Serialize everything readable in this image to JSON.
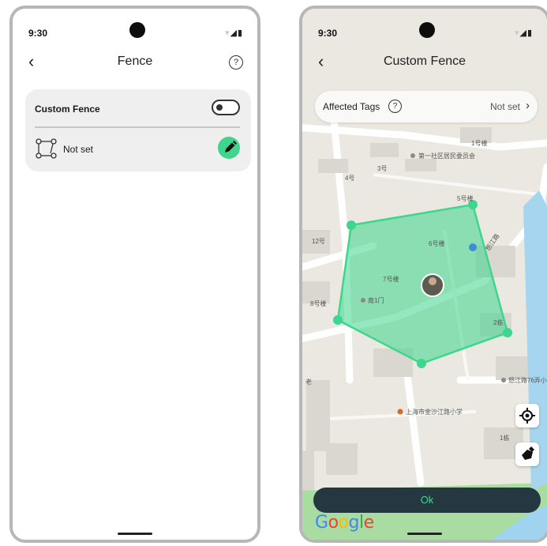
{
  "left_screen": {
    "status": {
      "time": "9:30"
    },
    "header": {
      "title": "Fence",
      "back_icon": "‹",
      "help_icon": "?"
    },
    "card": {
      "custom_fence_label": "Custom Fence",
      "custom_fence_toggle_on": false,
      "fence_value": "Not set"
    }
  },
  "right_screen": {
    "status": {
      "time": "9:30"
    },
    "header": {
      "title": "Custom Fence",
      "back_icon": "‹"
    },
    "tags": {
      "label": "Affected Tags",
      "help_icon": "?",
      "value": "Not set",
      "chevron": "›"
    },
    "map_labels": [
      {
        "text": "1号楼"
      },
      {
        "text": "第一社区居民委员会"
      },
      {
        "text": "3号"
      },
      {
        "text": "4号"
      },
      {
        "text": "5号楼"
      },
      {
        "text": "12号"
      },
      {
        "text": "6号楼"
      },
      {
        "text": "7号楼"
      },
      {
        "text": "8号楼"
      },
      {
        "text": "南1门"
      },
      {
        "text": "2栋"
      },
      {
        "text": "怒江路76弄小区"
      },
      {
        "text": "上海市金沙江路小学"
      },
      {
        "text": "1栋"
      },
      {
        "text": "怒江路"
      },
      {
        "text": "老"
      }
    ],
    "fence_color": "#3dd68c",
    "ok_label": "Ok",
    "google_logo": "Google"
  }
}
